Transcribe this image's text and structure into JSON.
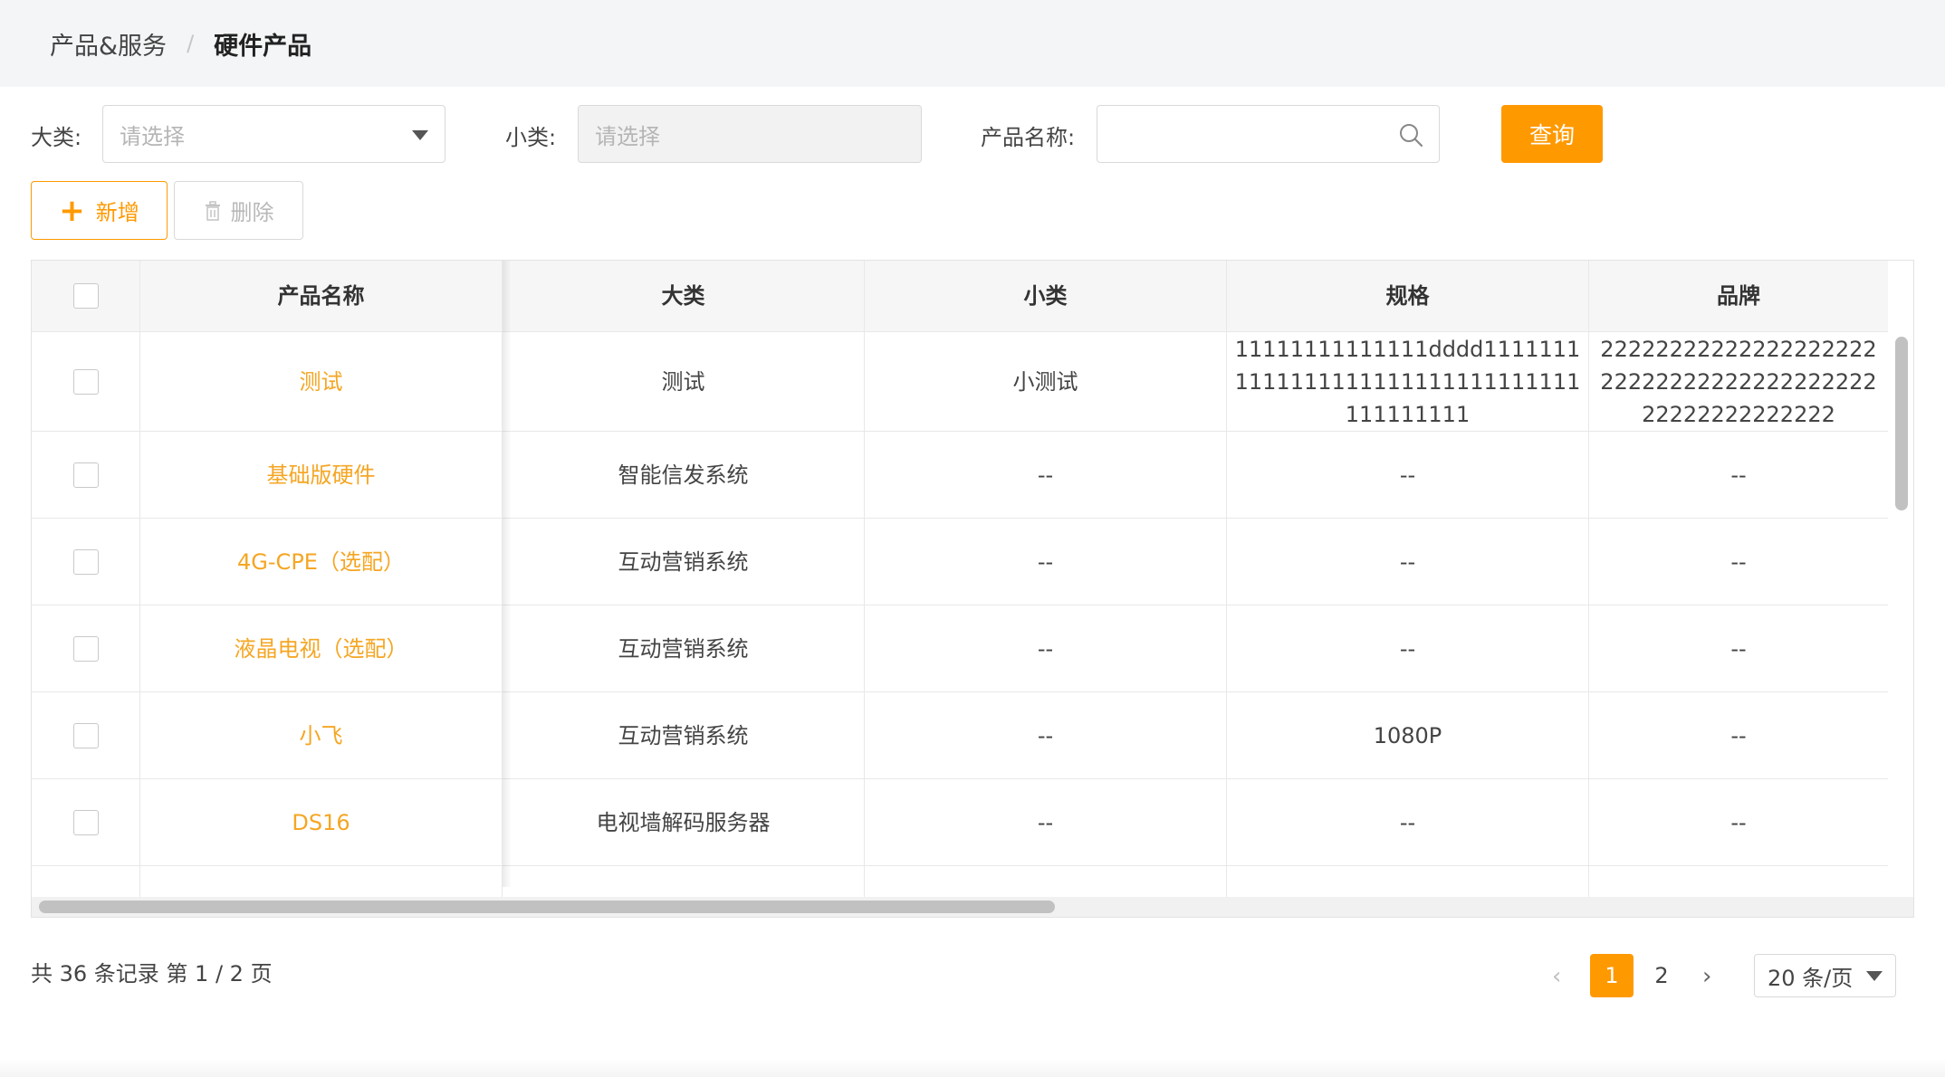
{
  "breadcrumb": {
    "parent": "产品&服务",
    "separator": "/",
    "current": "硬件产品"
  },
  "filters": {
    "category_label": "大类:",
    "category_placeholder": "请选择",
    "subcategory_label": "小类:",
    "subcategory_placeholder": "请选择",
    "name_label": "产品名称:",
    "name_value": "",
    "query_label": "查询"
  },
  "toolbar": {
    "add_label": "新增",
    "delete_label": "删除"
  },
  "table": {
    "headers": [
      "产品名称",
      "大类",
      "小类",
      "规格",
      "品牌"
    ],
    "rows": [
      {
        "name": "测试",
        "category": "测试",
        "subcategory": "小测试",
        "spec": "11111111111111dddd11111111111111111111111111111111111111111",
        "brand": "222222222222222222222222222222222222222222222222222222"
      },
      {
        "name": "基础版硬件",
        "category": "智能信发系统",
        "subcategory": "--",
        "spec": "--",
        "brand": "--"
      },
      {
        "name": "4G-CPE（选配）",
        "category": "互动营销系统",
        "subcategory": "--",
        "spec": "--",
        "brand": "--"
      },
      {
        "name": "液晶电视（选配）",
        "category": "互动营销系统",
        "subcategory": "--",
        "spec": "--",
        "brand": "--"
      },
      {
        "name": "小飞",
        "category": "互动营销系统",
        "subcategory": "--",
        "spec": "1080P",
        "brand": "--"
      },
      {
        "name": "DS16",
        "category": "电视墙解码服务器",
        "subcategory": "--",
        "spec": "--",
        "brand": "--"
      }
    ]
  },
  "pagination": {
    "summary": "共 36 条记录 第 1 / 2 页",
    "prev": "‹",
    "pages": [
      "1",
      "2"
    ],
    "current_page": "1",
    "next": "›",
    "page_size": "20 条/页"
  },
  "colors": {
    "accent": "#ff9900",
    "link": "#f5a623"
  }
}
